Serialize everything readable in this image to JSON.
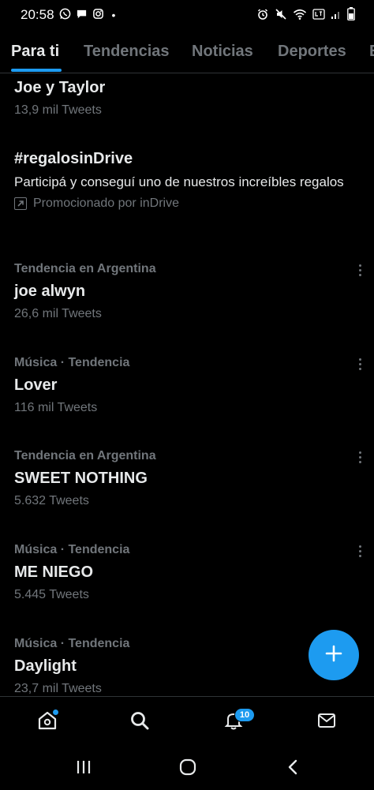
{
  "status_bar": {
    "time": "20:58",
    "dot": "•",
    "left_icons": [
      "whatsapp-icon",
      "message-icon",
      "instagram-icon"
    ],
    "right_icons": [
      "alarm-icon",
      "mute-icon",
      "wifi-icon",
      "lte-icon",
      "signal-icon",
      "battery-icon"
    ]
  },
  "tabs": [
    {
      "label": "Para ti",
      "active": true
    },
    {
      "label": "Tendencias",
      "active": false
    },
    {
      "label": "Noticias",
      "active": false
    },
    {
      "label": "Deportes",
      "active": false
    },
    {
      "label": "E",
      "active": false
    }
  ],
  "feed": {
    "items": [
      {
        "title": "Joe y Taylor",
        "count": "13,9 mil Tweets"
      },
      {
        "title": "#regalosinDrive",
        "description": "Participá y conseguí uno de nuestros increíbles regalos",
        "promo": "Promocionado por inDrive"
      },
      {
        "meta": "Tendencia en Argentina",
        "title": "joe alwyn",
        "count": "26,6 mil Tweets"
      },
      {
        "meta": "Música · Tendencia",
        "title": "Lover",
        "count": "116 mil Tweets"
      },
      {
        "meta": "Tendencia en Argentina",
        "title": "SWEET NOTHING",
        "count": "5.632 Tweets"
      },
      {
        "meta": "Música · Tendencia",
        "title": "ME NIEGO",
        "count": "5.445 Tweets"
      },
      {
        "meta": "Música · Tendencia",
        "title": "Daylight",
        "count": "23,7 mil Tweets"
      }
    ]
  },
  "fab": {
    "icon": "plus-icon"
  },
  "bottom_nav": {
    "items": [
      "home-icon",
      "search-icon",
      "notifications-icon",
      "messages-icon"
    ],
    "notification_count": "10"
  },
  "system_nav": [
    "recents-icon",
    "home-circle-icon",
    "back-icon"
  ],
  "colors": {
    "background": "#000000",
    "accent": "#1d9bf0",
    "primary_text": "#e7e9ea",
    "secondary_text": "#71767b",
    "divider": "#2f3336"
  }
}
